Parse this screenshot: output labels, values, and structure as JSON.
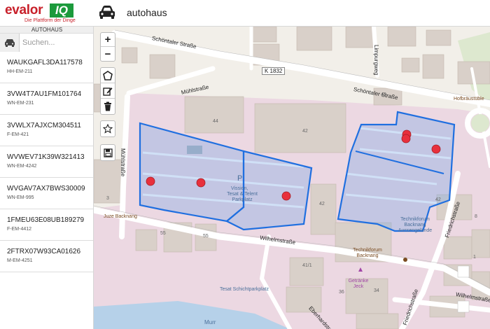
{
  "header": {
    "logo_word": "evalor",
    "logo_iq": "IQ",
    "logo_tagline": "Die Plattform der Dinge",
    "title": "autohaus",
    "car_icon": "car-icon"
  },
  "sidebar": {
    "heading": "AUTOHAUS",
    "search_placeholder": "Suchen...",
    "vehicles": [
      {
        "vin": "WAUKGAFL3DA117578",
        "plate": "HH-EM-211"
      },
      {
        "vin": "3VW4T7AU1FM101764",
        "plate": "WN-EM-231"
      },
      {
        "vin": "3VWLX7AJXCM304511",
        "plate": "F-EM-421"
      },
      {
        "vin": "WVWEV71K39W321413",
        "plate": "WN-EM-4242"
      },
      {
        "vin": "WVGAV7AX7BWS30009",
        "plate": "WN-EM-995"
      },
      {
        "vin": "1FMEU63E08UB189279",
        "plate": "F-EM-4412"
      },
      {
        "vin": "2FTRX07W93CA01626",
        "plate": "M-EM-4251"
      }
    ]
  },
  "map": {
    "controls": {
      "zoom_in": "+",
      "zoom_out": "−",
      "icons": [
        "polygon-icon",
        "edit-icon",
        "trash-icon",
        "star-icon",
        "save-icon"
      ]
    },
    "streets": {
      "schoentaler_1": "Schöntaler Straße",
      "schoentaler_2": "Schöntaler Straße",
      "k1832": "K 1832",
      "muehlstrasse": "Mühlstraße",
      "muehlstrasse_v": "Mühlstraße",
      "wilhelmstrasse": "Wilhelmstraße",
      "wilhelmstrasse_2": "Wilhelmstraße",
      "limpurgweg": "Limpurgweg",
      "friedrichstrasse": "Friedrichstraße",
      "friedrichstrasse_2": "Friedrichstraße",
      "eberhardstrasse": "Eberhardstraße",
      "murr": "Murr"
    },
    "house_numbers": [
      "44",
      "42",
      "42",
      "42",
      "42",
      "41/1",
      "55",
      "55",
      "36",
      "34",
      "3",
      "1",
      "8"
    ],
    "pois": {
      "parking_label": "Tesat & Telent Parkplatz",
      "parking_prefix": "Vission,",
      "technikforum_aussen": "Technikforum Backnang Aussengelände",
      "technikforum": "Technikforum Backnang",
      "getraenke": "Getränke Jeck",
      "schicht": "Tesat Schichtparkplatz",
      "juze": "Juze Backnang",
      "hofbraeu": "Hofbräustüble",
      "p_sign": "P"
    },
    "markers_count": 7
  }
}
